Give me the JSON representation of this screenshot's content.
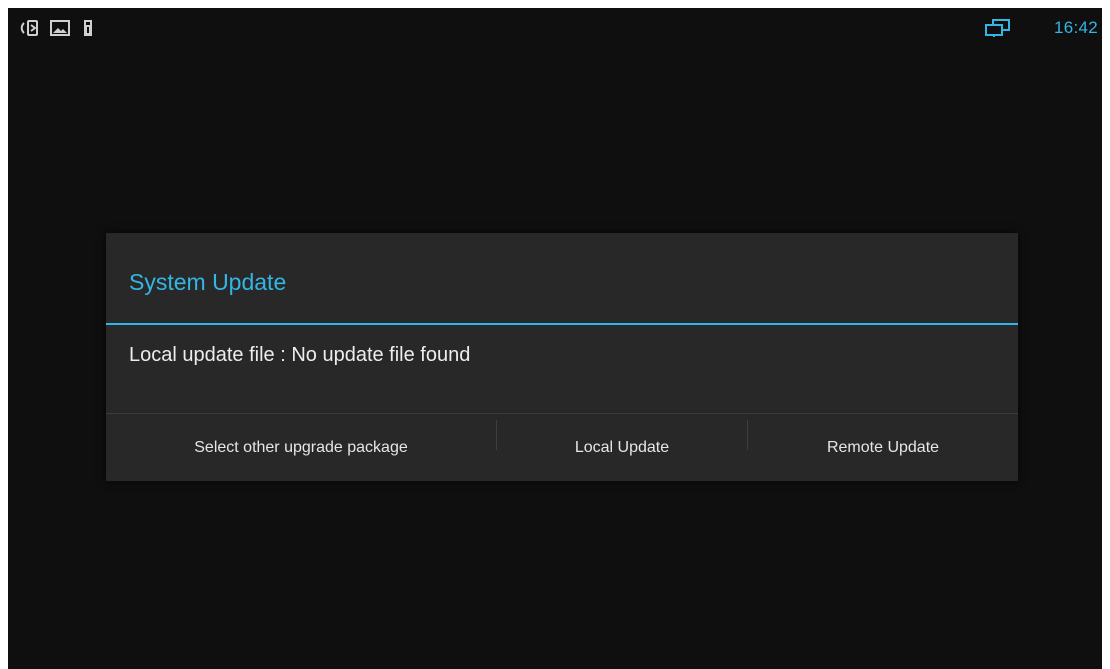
{
  "status_bar": {
    "time": "16:42",
    "accent_color": "#33b5e5",
    "icons": [
      "call-forward-icon",
      "picture-icon",
      "sd-card-icon",
      "network-screens-icon"
    ]
  },
  "dialog": {
    "title": "System Update",
    "message": "Local update file : No update file found",
    "buttons": {
      "select_other": "Select other upgrade package",
      "local_update": "Local Update",
      "remote_update": "Remote Update"
    }
  }
}
